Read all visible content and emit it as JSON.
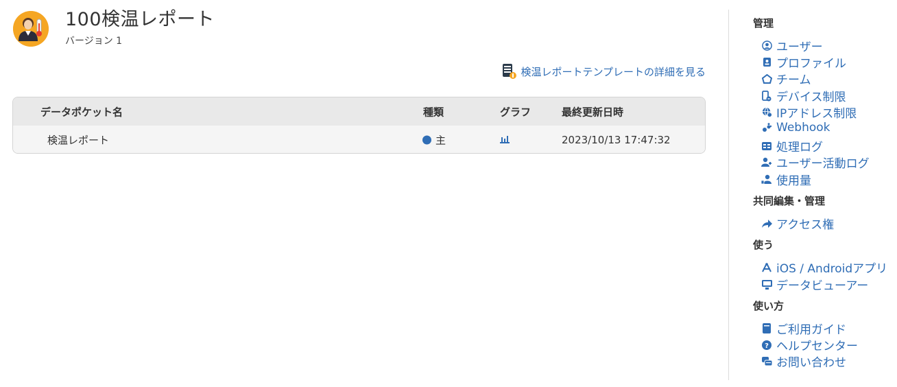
{
  "header": {
    "title": "100検温レポート",
    "version": "バージョン 1"
  },
  "template_link": {
    "label": "検温レポートテンプレートの詳細を見る"
  },
  "table": {
    "columns": [
      "データポケット名",
      "種類",
      "グラフ",
      "最終更新日時"
    ],
    "rows": [
      {
        "name": "検温レポート",
        "kind": "主",
        "graph_icon": "bar-chart-icon",
        "updated": "2023/10/13 17:47:32"
      }
    ]
  },
  "sidebar": {
    "sections": [
      {
        "title": "管理",
        "items": [
          {
            "label": "ユーザー",
            "icon": "user-circle-icon"
          },
          {
            "label": "プロファイル",
            "icon": "id-card-icon"
          },
          {
            "label": "チーム",
            "icon": "team-icon"
          },
          {
            "label": "デバイス制限",
            "icon": "device-restrict-icon"
          },
          {
            "label": "IPアドレス制限",
            "icon": "globe-icon"
          },
          {
            "label": "Webhook",
            "icon": "webhook-icon"
          },
          {
            "label": "処理ログ",
            "icon": "log-icon"
          },
          {
            "label": "ユーザー活動ログ",
            "icon": "user-activity-icon"
          },
          {
            "label": "使用量",
            "icon": "usage-icon"
          }
        ]
      },
      {
        "title": "共同編集・管理",
        "items": [
          {
            "label": "アクセス権",
            "icon": "share-arrow-icon"
          }
        ]
      },
      {
        "title": "使う",
        "items": [
          {
            "label": "iOS / Androidアプリ",
            "icon": "app-icon"
          },
          {
            "label": "データビューアー",
            "icon": "monitor-icon"
          }
        ]
      },
      {
        "title": "使い方",
        "items": [
          {
            "label": "ご利用ガイド",
            "icon": "book-icon"
          },
          {
            "label": "ヘルプセンター",
            "icon": "help-icon"
          },
          {
            "label": "お問い合わせ",
            "icon": "chat-icon"
          }
        ]
      }
    ]
  },
  "colors": {
    "link": "#2f6db5",
    "app_icon_bg": "#f5a623",
    "table_header_bg": "#e9e9e9",
    "table_row_bg": "#f5f5f5"
  }
}
